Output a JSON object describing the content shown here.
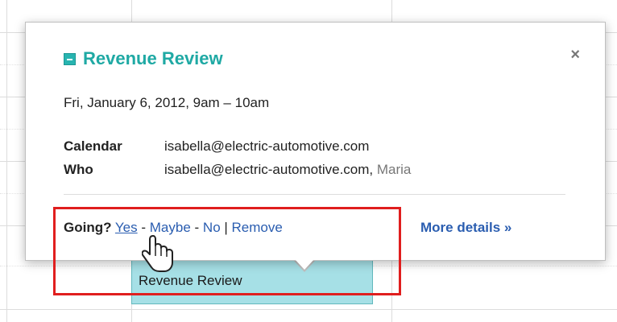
{
  "popup": {
    "title": "Revenue Review",
    "close_label": "×",
    "datetime": "Fri, January 6, 2012, 9am – 10am",
    "calendar_label": "Calendar",
    "calendar_value": "isabella@electric-automotive.com",
    "who_label": "Who",
    "who_value": "isabella@electric-automotive.com,",
    "who_extra": "Maria",
    "going_label": "Going?",
    "rsvp_yes": "Yes",
    "rsvp_maybe": "Maybe",
    "rsvp_no": "No",
    "rsvp_remove": "Remove",
    "more_details": "More details »"
  },
  "event_chip": {
    "title": "Revenue Review"
  },
  "icons": {
    "calendar_color": "calendar-color-icon",
    "close": "close-icon",
    "cursor": "hand-pointer-icon"
  },
  "colors": {
    "accent": "#1fa9a4",
    "link": "#2a5db0",
    "event_bg": "#a6e0e6",
    "highlight": "#e01e1e"
  }
}
